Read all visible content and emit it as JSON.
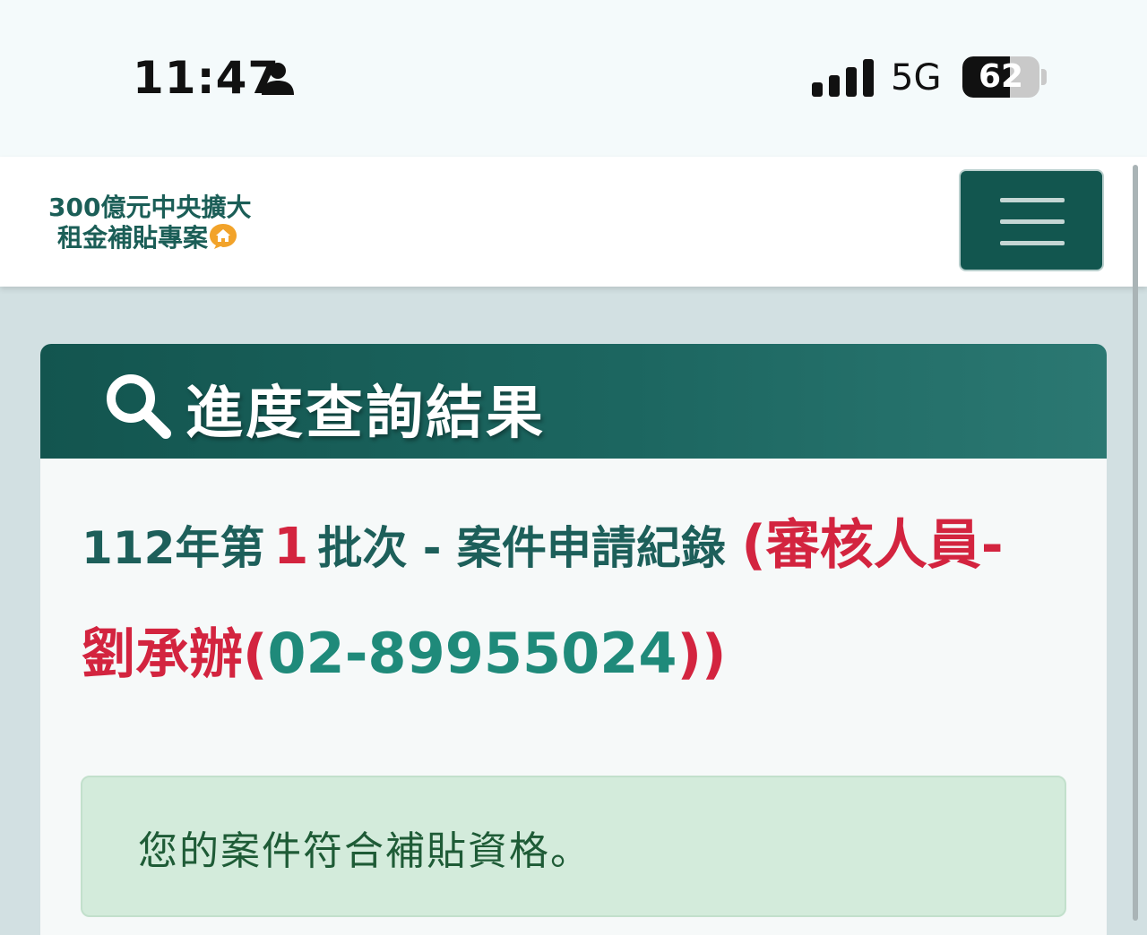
{
  "status_bar": {
    "time": "11:47",
    "network": "5G",
    "battery_level": "62",
    "battery_fraction": 0.62
  },
  "navbar": {
    "logo_line_1": "300億元中央擴大",
    "logo_line_2": "租金補貼專案",
    "menu_icon": "hamburger-icon"
  },
  "card": {
    "icon": "search-icon",
    "title": "進度查詢結果",
    "record": {
      "prefix": "112年第",
      "batch": "1",
      "middle": "批次 - 案件申請紀錄",
      "reviewer_open": "(審核人員-劉承辦(",
      "phone": "02-89955024",
      "reviewer_close": "))"
    },
    "alert_message": "您的案件符合補貼資格。"
  },
  "colors": {
    "brand_dark": "#12564f",
    "accent_red": "#d3243f",
    "phone_teal": "#1f8a7a",
    "alert_bg": "#d3ebdb",
    "alert_text": "#1e5b36"
  }
}
